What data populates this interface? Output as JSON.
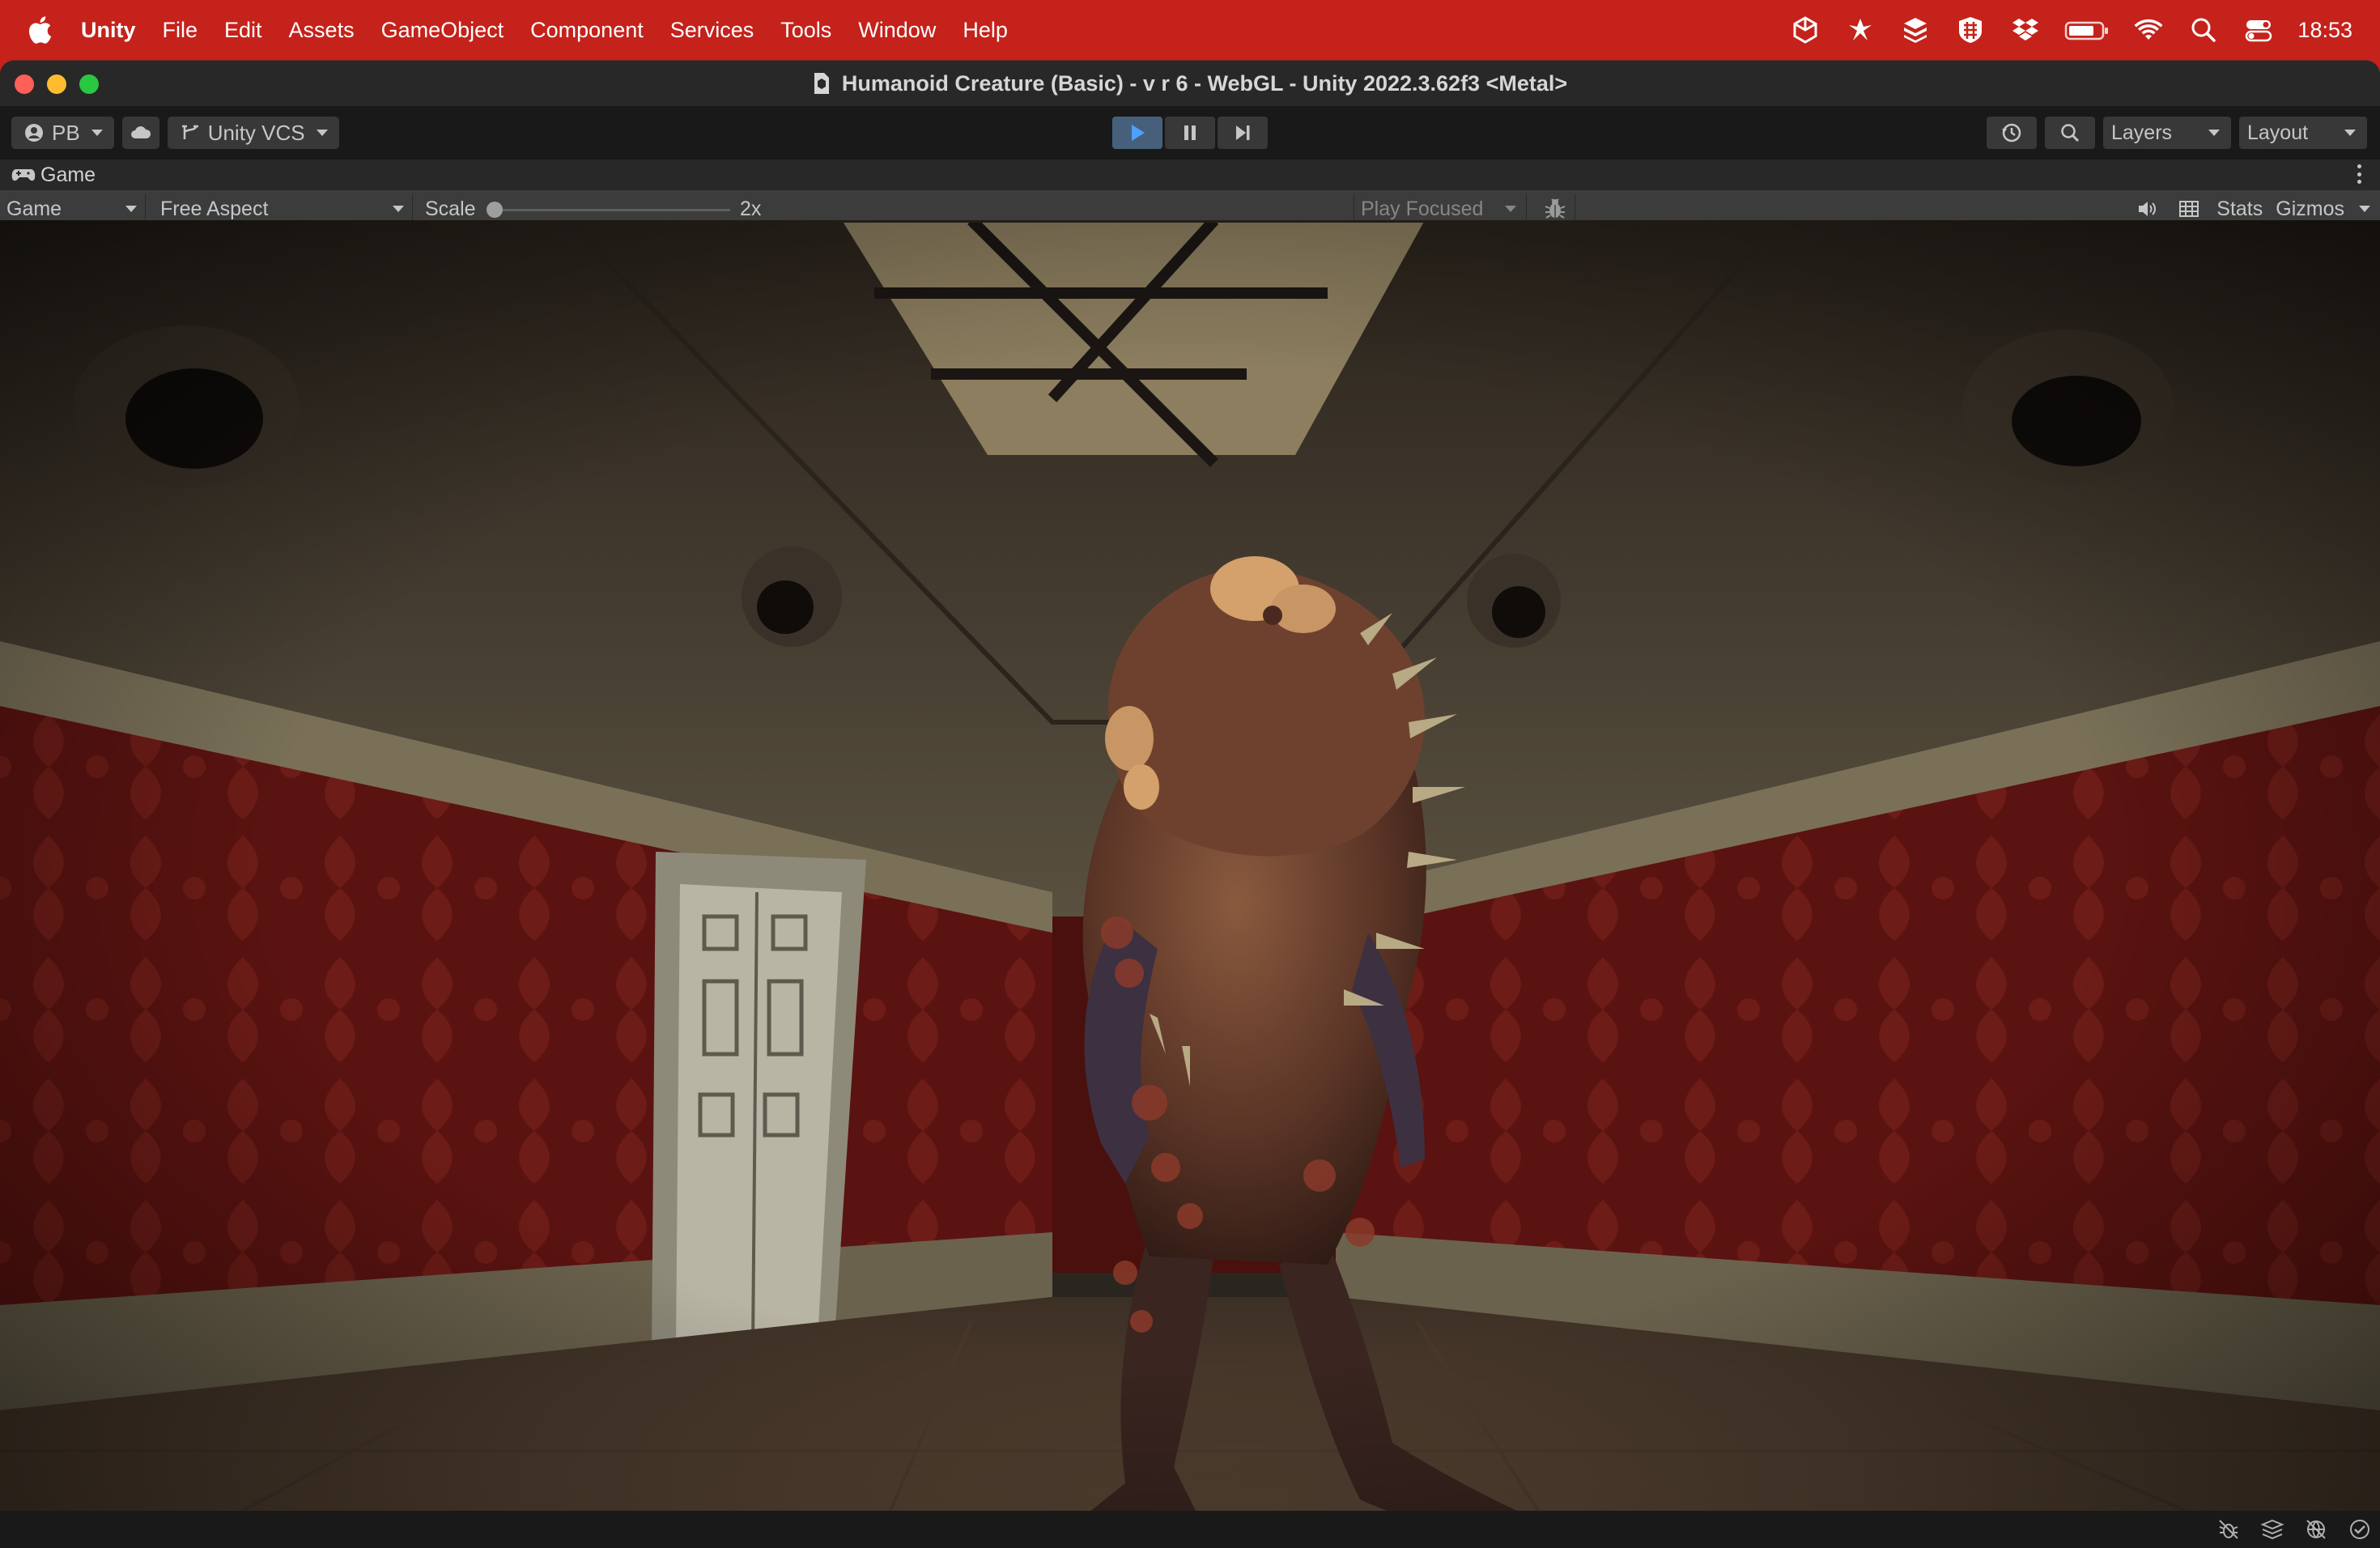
{
  "menubar": {
    "apple_icon": "apple-logo",
    "items": [
      "Unity",
      "File",
      "Edit",
      "Assets",
      "GameObject",
      "Component",
      "Services",
      "Tools",
      "Window",
      "Help"
    ],
    "status_icons": [
      "unity-hub-icon",
      "pinwheel-icon",
      "stack-icon",
      "grid-shield-icon",
      "dropbox-icon",
      "battery-icon",
      "wifi-icon",
      "spotlight-search-icon",
      "control-center-icon"
    ],
    "clock": "18:53",
    "bg_color": "#c4221b"
  },
  "window": {
    "title": "Humanoid Creature (Basic) - v r 6 - WebGL - Unity 2022.3.62f3 <Metal>"
  },
  "toolbar": {
    "account_label": "PB",
    "cloud_icon": "cloud-icon",
    "vcs_label": "Unity VCS",
    "play_state": "stopped",
    "history_icon": "history-icon",
    "search_icon": "search-icon",
    "layers_label": "Layers",
    "layout_label": "Layout"
  },
  "tab": {
    "icon": "gamepad-icon",
    "label": "Game"
  },
  "game_bar": {
    "display_label": "Game",
    "aspect_label": "Free Aspect",
    "scale_label": "Scale",
    "scale_value": "2x",
    "play_mode_label": "Play Focused",
    "debug_icon": "bug-icon",
    "audio_icon": "speaker-icon",
    "stats_grid_icon": "grid-icon",
    "stats_label": "Stats",
    "gizmos_label": "Gizmos"
  },
  "viewport": {
    "scene": "3d-room-with-humanoid-creature",
    "wall_color": "#5a1310",
    "floor_color": "#4a3a2a"
  },
  "statusbar": {
    "icons": [
      "debug-off-icon",
      "layers-stack-icon",
      "network-off-icon",
      "check-circle-icon"
    ]
  }
}
